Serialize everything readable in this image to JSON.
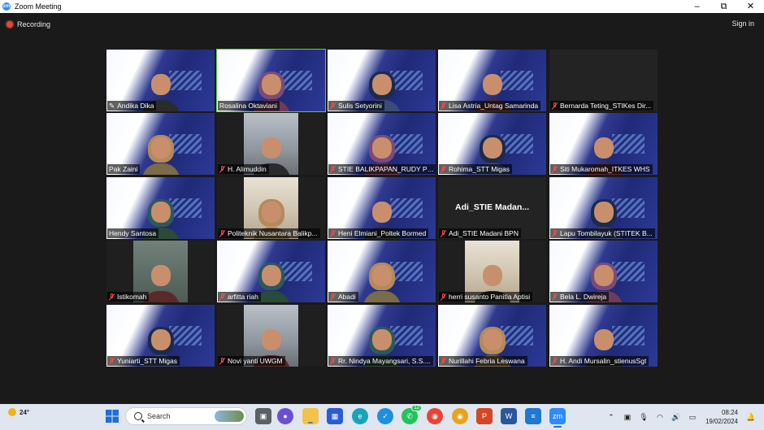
{
  "window": {
    "app_icon_text": "zm",
    "title": "Zoom Meeting",
    "controls": {
      "minimize": "–",
      "maximize": "⧉",
      "close": "✕"
    }
  },
  "top": {
    "recording": "Recording",
    "sign_in": "Sign in"
  },
  "gallery": [
    {
      "name": "Andika Dika",
      "style": "slide",
      "muted": false,
      "pinned": true
    },
    {
      "name": "Rosalina Oktaviani",
      "style": "slide",
      "muted": false,
      "active": true
    },
    {
      "name": "Sulis Setyorini",
      "style": "slide",
      "muted": true
    },
    {
      "name": "Lisa Astria_Untag Samarinda",
      "style": "slide",
      "muted": true
    },
    {
      "name": "Bernarda Teting_STIKes Dir...",
      "style": "dark",
      "muted": true
    },
    {
      "name": "Pak Zaini",
      "style": "slide",
      "muted": false
    },
    {
      "name": "H. Alimuddin",
      "style": "photo",
      "muted": true
    },
    {
      "name": "STIE BALIKPAPAN_RUDY PU...",
      "style": "slide",
      "muted": true
    },
    {
      "name": "Rohima_STT Migas",
      "style": "slide",
      "muted": true
    },
    {
      "name": "Siti Mukaromah_ITKES WHS",
      "style": "slide",
      "muted": true
    },
    {
      "name": "Hendy Santosa",
      "style": "slide",
      "muted": false
    },
    {
      "name": "Politeknik Nusantara Balikp...",
      "style": "room",
      "muted": true
    },
    {
      "name": "Heni Elmiani_Poltek Bormed",
      "style": "slide",
      "muted": true
    },
    {
      "name": "Adi_STIE Madani BPN",
      "style": "dark",
      "muted": true,
      "big_label": "Adi_STIE  Madan..."
    },
    {
      "name": "Lapu Tombilayuk (STITEK B...",
      "style": "slide",
      "muted": true
    },
    {
      "name": "Istikomah",
      "style": "green",
      "muted": true
    },
    {
      "name": "arfitta riah",
      "style": "slide",
      "muted": true
    },
    {
      "name": "Abadi",
      "style": "slide",
      "muted": true
    },
    {
      "name": "herri susanto Panitia Aptisi",
      "style": "room",
      "muted": true
    },
    {
      "name": "Bela L. Dwireja",
      "style": "slide",
      "muted": true
    },
    {
      "name": "Yuniarti_STT Migas",
      "style": "slide",
      "muted": true
    },
    {
      "name": "Novi yanti UWGM",
      "style": "photo",
      "muted": true
    },
    {
      "name": "Rr. Nindya Mayangsari, S.S....",
      "style": "slide",
      "muted": true
    },
    {
      "name": "Nurillahi Febria Leswana",
      "style": "slide",
      "muted": true
    },
    {
      "name": "H. Andi Mursalin_stienusSgt",
      "style": "slide",
      "muted": true
    }
  ],
  "taskbar": {
    "weather_temp": "24°",
    "search_placeholder": "Search",
    "whatsapp_badge": "12",
    "clock_time": "08:24",
    "clock_date": "19/02/2024"
  },
  "colors": {
    "accent_active": "#5bd43c",
    "mute_red": "#ff4b4b",
    "zoom_blue": "#2d8cff",
    "slide_blue": "#1f2a78"
  }
}
